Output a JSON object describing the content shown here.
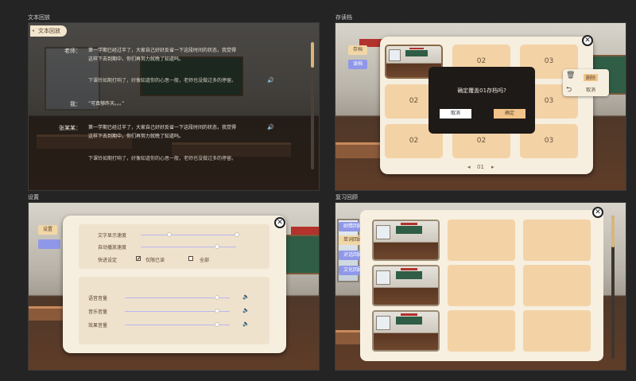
{
  "panels": {
    "history": {
      "caption": "文本回放",
      "tag": "文本回放"
    },
    "saves": {
      "caption": "存读档"
    },
    "settings": {
      "caption": "设置"
    },
    "review": {
      "caption": "复习回顾"
    }
  },
  "history": {
    "entries": [
      {
        "speaker": "老师：",
        "line1": "第一学期已经过半了，大家自己好好反省一下这段时间的状态，我觉得",
        "line2": "这样下去到期中，你们再努力就晚了知道吗。",
        "line3": "下课铃如期打响了，好像知道你的心思一般，老师也没做过多的停留。"
      },
      {
        "speaker": "我：",
        "line1": "“可真够昨天。。。”"
      },
      {
        "speaker": "张某某：",
        "line1": "第一学期已经过半了，大家自己好好反省一下这段时间的状态，我觉得",
        "line2": "这样下去到期中，你们再努力就晚了知道吗。",
        "line3": "下课铃如期打响了，好像知道你的心思一般，老师也没做过多的停留。"
      }
    ],
    "scroll_position": 0.0
  },
  "saves": {
    "tabs": [
      {
        "label": "存档",
        "active": true
      },
      {
        "label": "读档",
        "active": false
      }
    ],
    "slots": [
      "01",
      "02",
      "03",
      "02",
      "02",
      "03",
      "02",
      "02",
      "03"
    ],
    "pager": {
      "prev": "◂",
      "page": "01",
      "next": "▸"
    },
    "confirm": {
      "message": "确定覆盖01存档吗?",
      "cancel": "取消",
      "ok": "确定"
    },
    "context_menu": {
      "items": [
        {
          "icon": "trash-icon",
          "glyph": "🗑",
          "label": "删除"
        },
        {
          "icon": "undo-icon",
          "glyph": "⮌",
          "label": "取消"
        }
      ]
    }
  },
  "settings": {
    "tab": "设置",
    "text_speed": {
      "label": "文字显示速度",
      "value": 0.3
    },
    "auto_speed": {
      "label": "自动播放速度",
      "value": 0.3
    },
    "skip": {
      "label": "快进设定",
      "options": [
        {
          "label": "仅限已读",
          "checked": true,
          "mark": "✔"
        },
        {
          "label": "全部",
          "checked": false,
          "mark": ""
        }
      ]
    },
    "volumes": [
      {
        "label": "语音音量",
        "value": 0.88
      },
      {
        "label": "音乐音量",
        "value": 0.88
      },
      {
        "label": "效果音量",
        "value": 0.88
      }
    ],
    "speaker_glyph": "🔈"
  },
  "review": {
    "tabs": [
      {
        "label": "剧情回顾",
        "active": false
      },
      {
        "label": "单词回顾",
        "active": true
      },
      {
        "label": "对话回顾",
        "active": false
      },
      {
        "label": "文化回顾",
        "active": false
      }
    ],
    "scroll_position": 0.0
  },
  "close_glyph": "✕",
  "voice_glyph": "🔊"
}
